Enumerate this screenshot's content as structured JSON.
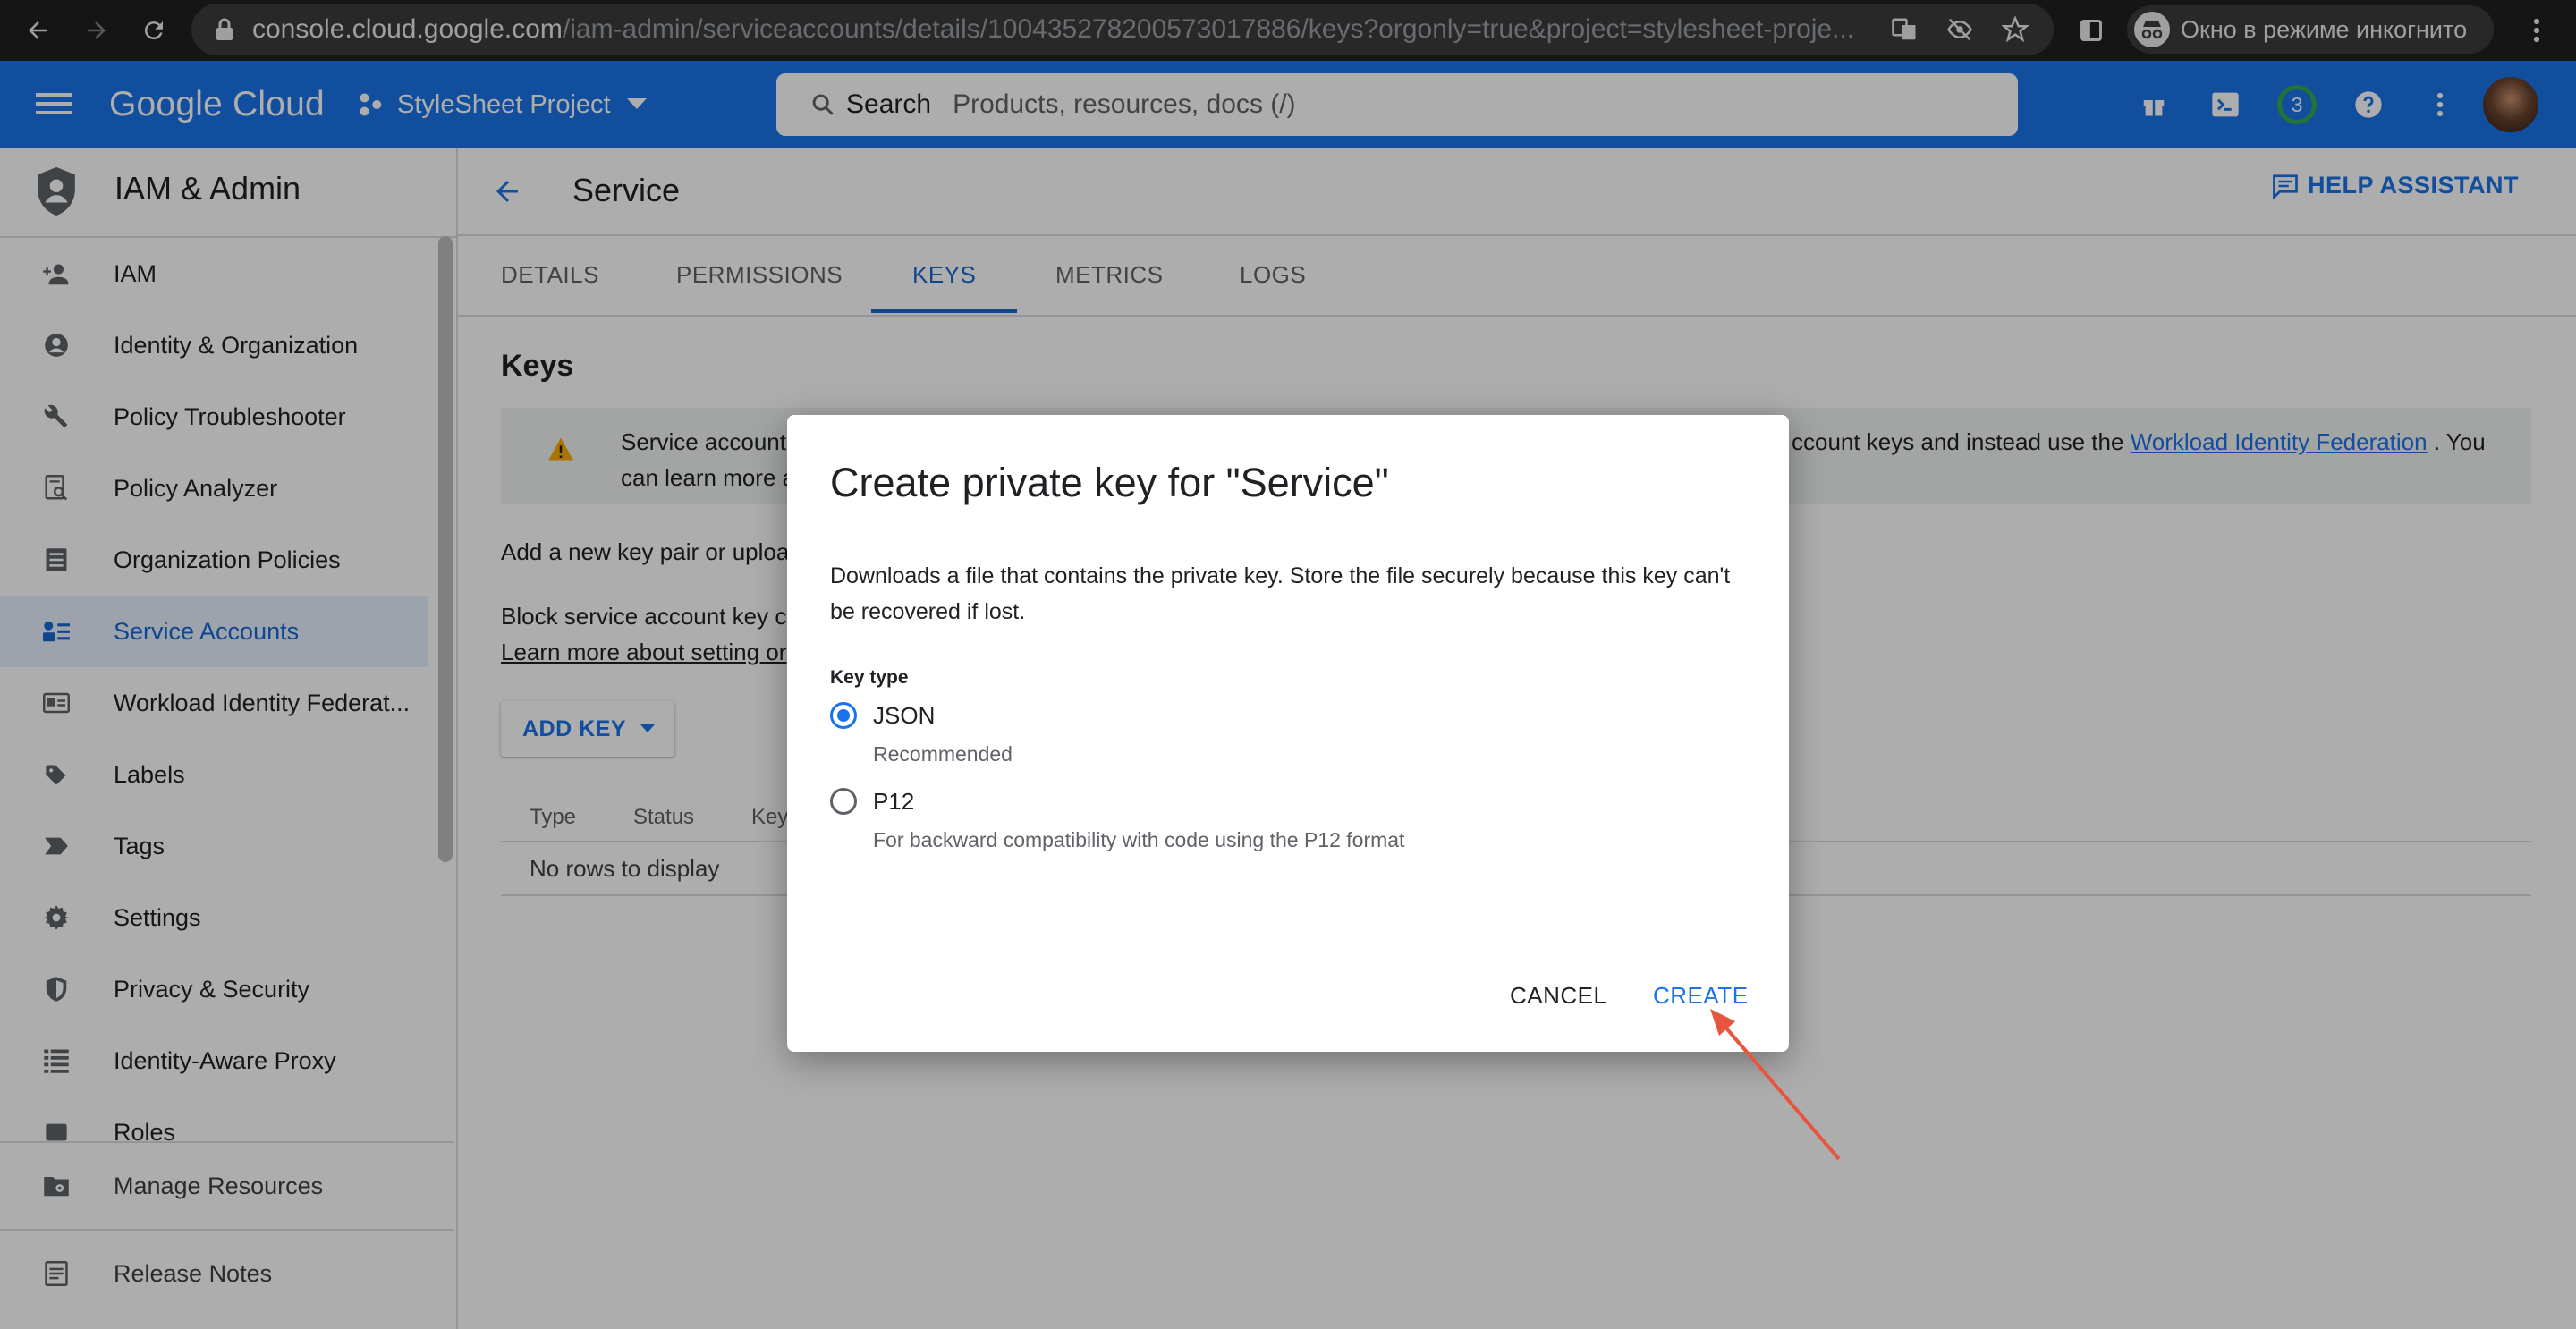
{
  "browser": {
    "url_host": "console.cloud.google.com",
    "url_path": "/iam-admin/serviceaccounts/details/100435278200573017886/keys?orgonly=true&project=stylesheet-proje...",
    "incognito_label": "Окно в режиме инкогнито"
  },
  "header": {
    "brand": "Google Cloud",
    "project": "StyleSheet Project",
    "search_label": "Search",
    "search_placeholder": "Products, resources, docs (/)",
    "notifications_count": "3"
  },
  "sidebar": {
    "title": "IAM & Admin",
    "items": [
      {
        "label": "IAM",
        "icon": "person-add-icon"
      },
      {
        "label": "Identity & Organization",
        "icon": "account-circle-icon"
      },
      {
        "label": "Policy Troubleshooter",
        "icon": "wrench-icon"
      },
      {
        "label": "Policy Analyzer",
        "icon": "document-search-icon"
      },
      {
        "label": "Organization Policies",
        "icon": "list-document-icon"
      },
      {
        "label": "Service Accounts",
        "icon": "service-account-icon",
        "active": true
      },
      {
        "label": "Workload Identity Federat...",
        "icon": "id-card-icon"
      },
      {
        "label": "Labels",
        "icon": "label-icon"
      },
      {
        "label": "Tags",
        "icon": "tag-icon"
      },
      {
        "label": "Settings",
        "icon": "gear-icon"
      },
      {
        "label": "Privacy & Security",
        "icon": "shield-icon"
      },
      {
        "label": "Identity-Aware Proxy",
        "icon": "proxy-icon"
      },
      {
        "label": "Roles",
        "icon": "roles-icon"
      }
    ],
    "bottom": [
      {
        "label": "Manage Resources",
        "icon": "folder-gear-icon"
      },
      {
        "label": "Release Notes",
        "icon": "notes-icon"
      }
    ]
  },
  "main": {
    "title": "Service",
    "help_label": "HELP ASSISTANT",
    "tabs": [
      {
        "label": "DETAILS"
      },
      {
        "label": "PERMISSIONS"
      },
      {
        "label": "KEYS",
        "active": true
      },
      {
        "label": "METRICS"
      },
      {
        "label": "LOGS"
      }
    ],
    "section_title": "Keys",
    "banner_line1_start": "Service account",
    "banner_line1_end": "ccount keys and instead use the ",
    "banner_link": "Workload Identity Federation",
    "banner_line1_tail": " . You",
    "banner_line2": "can learn more a",
    "add_text": "Add a new key pair or uploa",
    "block_text": "Block service account key c",
    "learn_link": "Learn more about setting or",
    "add_key_label": "ADD KEY",
    "table": {
      "columns": [
        "Type",
        "Status",
        "Key"
      ],
      "empty": "No rows to display"
    }
  },
  "dialog": {
    "title": "Create private key for \"Service\"",
    "description": "Downloads a file that contains the private key. Store the file securely because this key can't be recovered if lost.",
    "key_type_label": "Key type",
    "options": [
      {
        "label": "JSON",
        "sub": "Recommended",
        "checked": true
      },
      {
        "label": "P12",
        "sub": "For backward compatibility with code using the P12 format",
        "checked": false
      }
    ],
    "cancel_label": "CANCEL",
    "create_label": "CREATE"
  },
  "colors": {
    "header_blue": "#1a73e8",
    "accent": "#1967d2",
    "annotation_arrow": "#e8553e"
  }
}
